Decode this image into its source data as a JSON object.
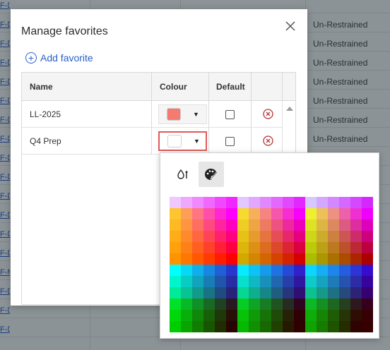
{
  "background": {
    "rows": [
      {
        "link": "F-D",
        "status": ""
      },
      {
        "link": "F-D",
        "status": "Un-Restrained"
      },
      {
        "link": "F-D",
        "status": "Un-Restrained"
      },
      {
        "link": "F-D",
        "status": "Un-Restrained"
      },
      {
        "link": "F-D",
        "status": "Un-Restrained"
      },
      {
        "link": "F-D",
        "status": "Un-Restrained"
      },
      {
        "link": "F-D",
        "status": "Un-Restrained"
      },
      {
        "link": "F-D",
        "status": "Un-Restrained"
      },
      {
        "link": "F-D",
        "status": ""
      },
      {
        "link": "F-D",
        "status": ""
      },
      {
        "link": "F-D",
        "status": ""
      },
      {
        "link": "F-D",
        "status": ""
      },
      {
        "link": "F-D",
        "status": ""
      },
      {
        "link": "F-D",
        "status": ""
      },
      {
        "link": "F-M",
        "status": ""
      },
      {
        "link": "F-D",
        "status": ""
      },
      {
        "link": "F-D",
        "status": ""
      },
      {
        "link": "F-D",
        "status": ""
      }
    ]
  },
  "modal": {
    "title": "Manage favorites",
    "add_label": "Add favorite",
    "columns": {
      "name": "Name",
      "colour": "Colour",
      "default": "Default"
    },
    "rows": [
      {
        "name": "LL-2025",
        "colour": "#f57a72",
        "default": false
      },
      {
        "name": "Q4 Prep",
        "colour": "#ffffff",
        "default": false
      }
    ]
  },
  "picker": {
    "tabs": [
      {
        "icon": "color-drop-icon",
        "active": false
      },
      {
        "icon": "palette-brush-icon",
        "active": true
      }
    ]
  },
  "colors": {
    "accent": "#2960c9",
    "remove": "#b53434",
    "active_border": "#e05a5a"
  }
}
